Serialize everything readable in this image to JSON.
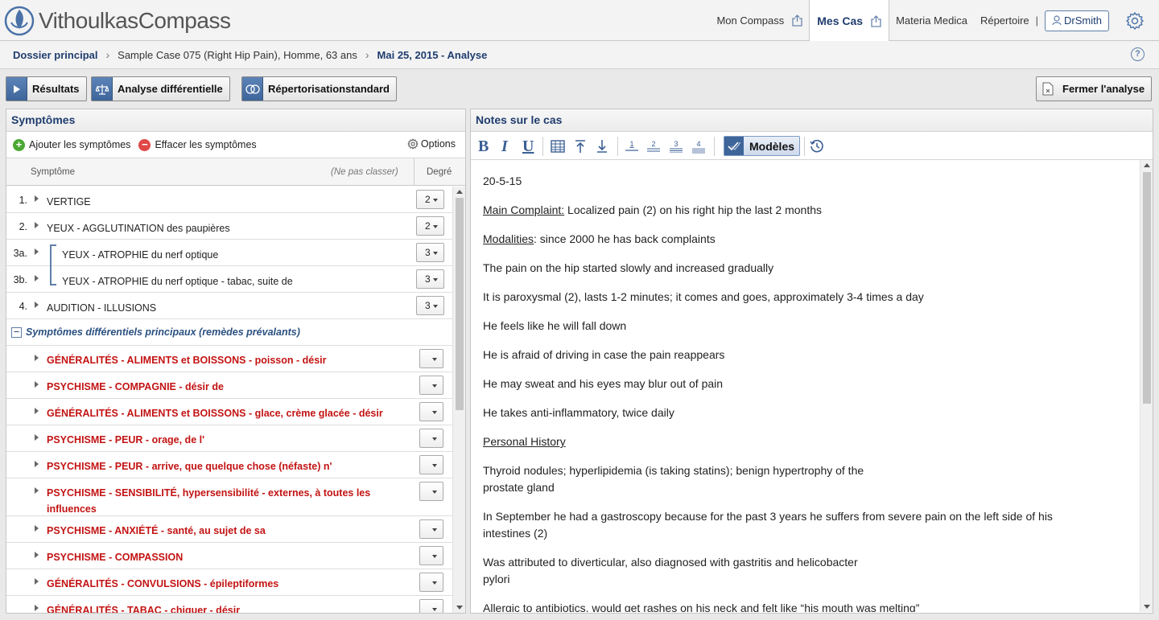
{
  "header": {
    "logo_part1": "Vithoulkas",
    "logo_part2": "Compass",
    "nav": [
      {
        "label": "Mon Compass",
        "active": false
      },
      {
        "label": "Mes Cas",
        "active": true
      },
      {
        "label": "Materia Medica",
        "active": false
      },
      {
        "label": "Répertoire",
        "active": false
      }
    ],
    "separator": "|",
    "user": "DrSmith"
  },
  "breadcrumb": {
    "items": [
      "Dossier principal",
      "Sample Case 075 (Right Hip Pain), Homme, 63 ans",
      "Mai 25, 2015 - Analyse"
    ],
    "help_label": "?"
  },
  "toolbar": {
    "results": "Résultats",
    "differential": "Analyse différentielle",
    "standard": "Répertorisationstandard",
    "close": "Fermer l'analyse"
  },
  "symptoms_panel": {
    "title": "Symptômes",
    "add": "Ajouter les symptômes",
    "clear": "Effacer les symptômes",
    "options": "Options",
    "add_glyph": "+",
    "clear_glyph": "−",
    "col_symptom": "Symptôme",
    "col_noclass": "(Ne pas classer)",
    "col_degree": "Degré",
    "rows": [
      {
        "num": "1.",
        "text": "VERTIGE",
        "degree": "2"
      },
      {
        "num": "2.",
        "text": "YEUX - AGGLUTINATION des paupières",
        "degree": "2"
      },
      {
        "num": "3a.",
        "text": "YEUX - ATROPHIE du nerf optique",
        "degree": "3"
      },
      {
        "num": "3b.",
        "text": "YEUX - ATROPHIE du nerf optique - tabac, suite de",
        "degree": "3"
      },
      {
        "num": "4.",
        "text": "AUDITION - ILLUSIONS",
        "degree": "3"
      }
    ],
    "group": {
      "collapse_glyph": "−",
      "label": "Symptômes différentiels principaux (remèdes prévalants)",
      "items": [
        "GÉNÉRALITÉS - ALIMENTS et BOISSONS - poisson - désir",
        "PSYCHISME - COMPAGNIE - désir de",
        "GÉNÉRALITÉS - ALIMENTS et BOISSONS - glace, crème glacée - désir",
        "PSYCHISME - PEUR - orage, de l'",
        "PSYCHISME - PEUR - arrive, que quelque chose (néfaste) n'",
        "PSYCHISME - SENSIBILITÉ, hypersensibilité - externes, à toutes les influences",
        "PSYCHISME - ANXIÉTÉ - santé, au sujet de sa",
        "PSYCHISME - COMPASSION",
        "GÉNÉRALITÉS - CONVULSIONS - épileptiformes",
        "GÉNÉRALITÉS - TABAC - chiquer - désir"
      ]
    }
  },
  "notes_panel": {
    "title": "Notes sur le cas",
    "toolbar": {
      "bold": "B",
      "italic": "I",
      "underline": "U",
      "h1": "1",
      "h2": "2",
      "h3": "3",
      "h4": "4",
      "templates": "Modèles"
    },
    "lines": {
      "date": "20-5-15",
      "main_label": "Main Complaint:",
      "main_text": " Localized pain (2) on his right hip the last 2 months",
      "mod_label": "Modalities",
      "mod_text": ": since 2000 he has back complaints",
      "l1": "The pain on the hip started slowly and increased gradually",
      "l2": "It is paroxysmal (2), lasts 1-2 minutes; it comes and goes, approximately 3-4 times a day",
      "l3": "He feels like he will fall down",
      "l4": "He is afraid of driving in case the pain reappears",
      "l5": "He may sweat and his eyes may blur out of pain",
      "l6": "He takes anti-inflammatory, twice daily",
      "personal": "Personal History",
      "l7a": "Thyroid nodules; hyperlipidemia (is taking statins); benign hypertrophy of the",
      "l7b": "prostate gland",
      "l8a": "In September he had a gastroscopy because for the past 3 years he suffers from severe pain on the left side of his",
      "l8b": "intestines (2)",
      "l9a": "Was attributed to diverticular, also diagnosed with gastritis and helicobacter",
      "l9b": "pylori",
      "l10": "Allergic to antibiotics, would get rashes on his neck and felt like “his mouth was melting”"
    }
  },
  "colors": {
    "accent": "#1f3d6e",
    "button_blue": "#3e6599",
    "symptom_red": "#c31313"
  }
}
